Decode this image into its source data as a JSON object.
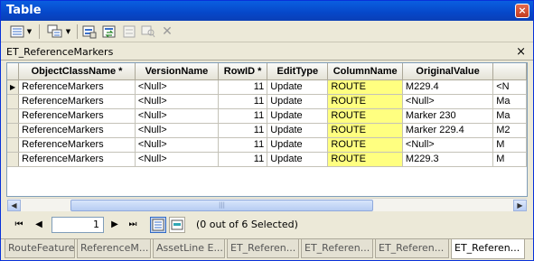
{
  "window": {
    "title": "Table",
    "close_label": "×"
  },
  "toolbar": {
    "buttons": [
      {
        "icon": "table-options-icon",
        "has_dropdown": true
      },
      {
        "icon": "related-tables-icon",
        "has_dropdown": true
      },
      {
        "icon": "select-by-attributes-icon"
      },
      {
        "icon": "switch-selection-icon"
      },
      {
        "icon": "clear-selection-icon"
      },
      {
        "icon": "zoom-to-selected-icon"
      },
      {
        "icon": "delete-selected-icon"
      }
    ]
  },
  "table_name": {
    "label": "ET_ReferenceMarkers",
    "close_label": "×"
  },
  "grid": {
    "columns": [
      "ObjectClassName *",
      "VersionName",
      "RowID *",
      "EditType",
      "ColumnName",
      "OriginalValue",
      ""
    ],
    "rows": [
      [
        "ReferenceMarkers",
        "<Null>",
        "11",
        "Update",
        "ROUTE",
        "M229.4",
        "<N"
      ],
      [
        "ReferenceMarkers",
        "<Null>",
        "11",
        "Update",
        "ROUTE",
        "<Null>",
        "Ma"
      ],
      [
        "ReferenceMarkers",
        "<Null>",
        "11",
        "Update",
        "ROUTE",
        "Marker 230",
        "Ma"
      ],
      [
        "ReferenceMarkers",
        "<Null>",
        "11",
        "Update",
        "ROUTE",
        "Marker 229.4",
        "M2"
      ],
      [
        "ReferenceMarkers",
        "<Null>",
        "11",
        "Update",
        "ROUTE",
        "<Null>",
        "M"
      ],
      [
        "ReferenceMarkers",
        "<Null>",
        "11",
        "Update",
        "ROUTE",
        " M229.3",
        "M"
      ]
    ],
    "current_row_indicator": "▶",
    "highlight_color": "#ffff80"
  },
  "navigation": {
    "first": "⏮",
    "prev": "◀",
    "record": "1",
    "next": "▶",
    "last": "⏭",
    "status": "(0 out of 6 Selected)"
  },
  "tabs": [
    "RouteFeature",
    "ReferenceM...",
    "AssetLine E...",
    "ET_Referen...",
    "ET_Referen...",
    "ET_Referen...",
    "ET_Referen..."
  ],
  "active_tab_index": 6
}
